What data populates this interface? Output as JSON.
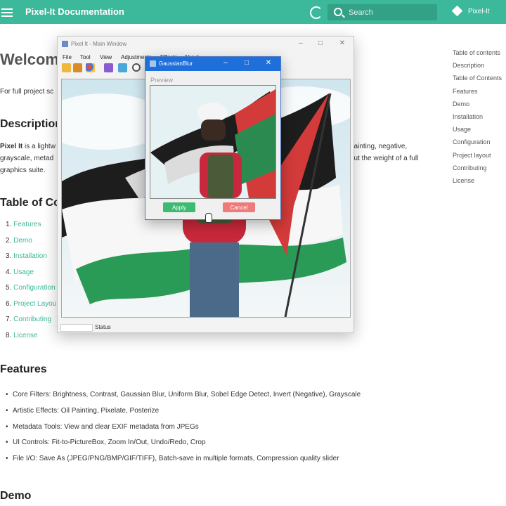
{
  "header": {
    "site_title": "Pixel-It Documentation",
    "search_placeholder": "Search",
    "repo_label": "Pixel-It"
  },
  "article": {
    "welcome": "Welcom",
    "intro": "For full project sc",
    "description_heading": "Description",
    "desc_line1_bold": "Pixel It",
    "desc_line1_rest": " is a lightw",
    "desc_line1_right": "painting, negative,",
    "desc_line2_left": "grayscale, metad",
    "desc_line2_right": "out the weight of a full",
    "desc_line3": "graphics suite.",
    "toc_heading": "Table of Co",
    "toc_items": [
      {
        "num": "1.",
        "label": "Features"
      },
      {
        "num": "2.",
        "label": "Demo"
      },
      {
        "num": "3.",
        "label": "Installation"
      },
      {
        "num": "4.",
        "label": "Usage"
      },
      {
        "num": "5.",
        "label": "Configuration"
      },
      {
        "num": "6.",
        "label": "Project Layou"
      },
      {
        "num": "7.",
        "label": "Contributing"
      },
      {
        "num": "8.",
        "label": "License"
      }
    ],
    "features_heading": "Features",
    "features": [
      "Core Filters: Brightness, Contrast, Gaussian Blur, Uniform Blur, Sobel Edge Detect, Invert (Negative), Grayscale",
      "Artistic Effects: Oil Painting, Pixelate, Posterize",
      "Metadata Tools: View and clear EXIF metadata from JPEGs",
      "UI Controls: Fit-to-PictureBox, Zoom In/Out, Undo/Redo, Crop",
      "File I/O: Save As (JPEG/PNG/BMP/GIF/TIFF), Batch-save in multiple formats, Compression quality slider"
    ],
    "demo_heading": "Demo"
  },
  "right_toc": [
    "Table of contents",
    "Description",
    "Table of Contents",
    "Features",
    "Demo",
    "Installation",
    "Usage",
    "Configuration",
    "Project layout",
    "Contributing",
    "License"
  ],
  "main_window": {
    "title": "Pixel It - Main Window",
    "menu": [
      "File",
      "Tool",
      "View",
      "Adjustments",
      "Effects",
      "About"
    ],
    "status": "Status"
  },
  "dialog": {
    "title": "GaussianBlur",
    "preview_label": "Preview",
    "apply": "Apply",
    "cancel": "Cancel"
  },
  "colors": {
    "brand": "#3cb89a",
    "dialog_title": "#1e6fd9",
    "apply_button": "#3dbb72",
    "cancel_button": "#ee7b7b"
  }
}
